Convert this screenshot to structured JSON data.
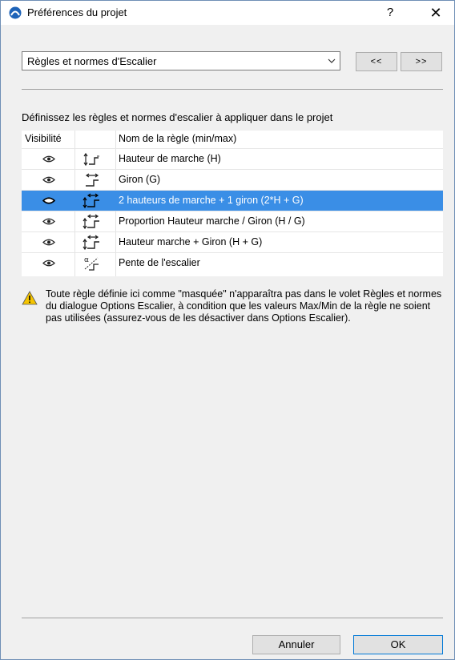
{
  "window": {
    "title": "Préférences du projet",
    "help": "?",
    "close": "✕"
  },
  "combo": {
    "value": "Règles et normes d'Escalier"
  },
  "nav": {
    "prev": "<<",
    "next": ">>"
  },
  "instructions": "Définissez les règles et normes d'escalier à appliquer dans le projet",
  "table": {
    "headers": {
      "visibility": "Visibilité",
      "name": "Nom de la règle (min/max)"
    },
    "rows": [
      {
        "name": "Hauteur de marche (H)",
        "icon": "riser-height-icon",
        "visible": true,
        "selected": false
      },
      {
        "name": "Giron (G)",
        "icon": "going-icon",
        "visible": true,
        "selected": false
      },
      {
        "name": "2 hauteurs de marche + 1 giron (2*H + G)",
        "icon": "riser-going-icon",
        "visible": true,
        "selected": true
      },
      {
        "name": "Proportion Hauteur marche / Giron (H / G)",
        "icon": "riser-going-icon",
        "visible": true,
        "selected": false
      },
      {
        "name": "Hauteur marche + Giron (H + G)",
        "icon": "riser-going-icon",
        "visible": true,
        "selected": false
      },
      {
        "name": "Pente de l'escalier",
        "icon": "slope-icon",
        "visible": true,
        "selected": false
      }
    ]
  },
  "warning": "Toute règle définie ici comme \"masquée\" n'apparaîtra pas dans le volet Règles et normes du dialogue Options Escalier, à condition que les valeurs Max/Min de la règle ne soient pas utilisées (assurez-vous de les désactiver dans Options Escalier).",
  "buttons": {
    "cancel": "Annuler",
    "ok": "OK"
  },
  "colors": {
    "selection": "#3a8ee6",
    "accent": "#0078d7"
  }
}
